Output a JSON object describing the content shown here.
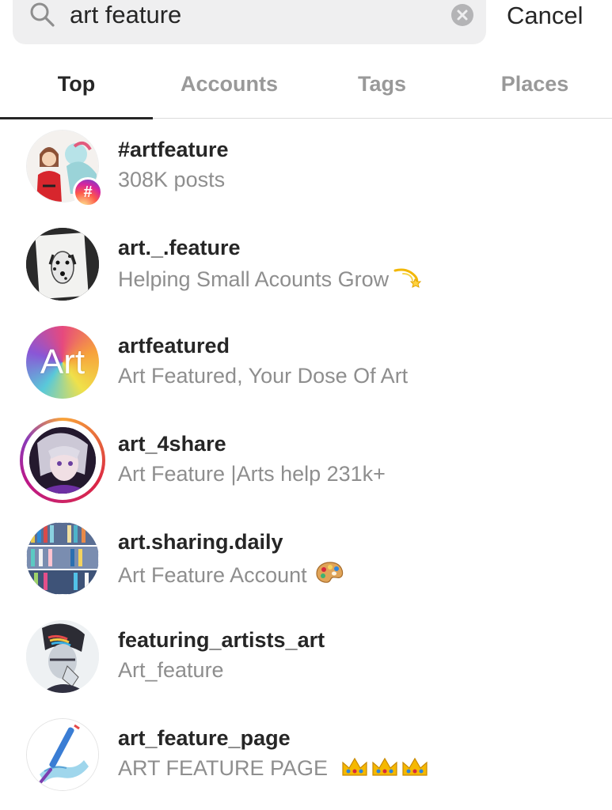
{
  "search": {
    "query": "art feature",
    "cancel_label": "Cancel"
  },
  "tabs": [
    {
      "label": "Top",
      "active": true
    },
    {
      "label": "Accounts",
      "active": false
    },
    {
      "label": "Tags",
      "active": false
    },
    {
      "label": "Places",
      "active": false
    }
  ],
  "results": [
    {
      "title": "#artfeature",
      "subtitle": "308K posts",
      "type": "hashtag"
    },
    {
      "title": "art._.feature",
      "subtitle": "Helping Small Acounts Grow",
      "emoji": "dizzy-icon"
    },
    {
      "title": "artfeatured",
      "subtitle": "Art Featured, Your Dose Of Art",
      "avatar_text": "Art"
    },
    {
      "title": "art_4share",
      "subtitle": "Art Feature |Arts help 231k+",
      "story_ring": true
    },
    {
      "title": "art.sharing.daily",
      "subtitle": "Art Feature Account",
      "emoji": "palette-icon"
    },
    {
      "title": "featuring_artists_art",
      "subtitle": "Art_feature"
    },
    {
      "title": "art_feature_page",
      "subtitle": "ART FEATURE PAGE",
      "emoji": "crown-icon"
    }
  ],
  "colors": {
    "text_primary": "#262626",
    "text_secondary": "#8e8e8e",
    "tab_inactive": "#999999",
    "search_bg": "#efeff0",
    "divider": "#dbdbdb"
  }
}
